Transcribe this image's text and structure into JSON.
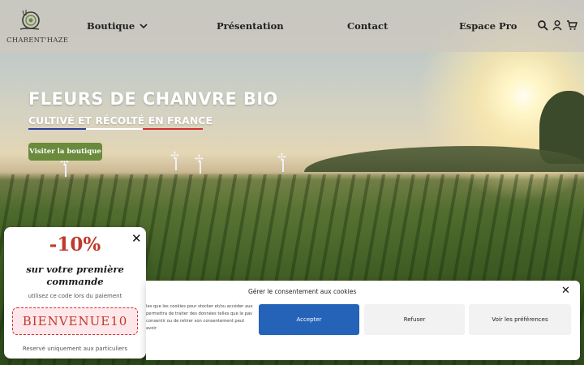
{
  "header": {
    "logo_text": "CHARENT'HAZE",
    "nav": [
      {
        "label": "Boutique",
        "has_dropdown": true
      },
      {
        "label": "Présentation"
      },
      {
        "label": "Contact"
      },
      {
        "label": "Espace Pro"
      }
    ],
    "icons": [
      "search-icon",
      "user-icon",
      "cart-icon"
    ]
  },
  "hero": {
    "title": "Fleurs de chanvre bio",
    "subtitle_part1": "Cultivé et récolté ",
    "subtitle_part2": "en France",
    "cta_label": "Visiter la boutique"
  },
  "promo": {
    "discount": "-10%",
    "line1": "sur votre première",
    "line2": "commande",
    "instruction": "utilisez ce code lors du paiement",
    "code": "BIENVENUE10",
    "note": "Reservé uniquement aux particuliers"
  },
  "cookie": {
    "title": "Gérer le consentement aux cookies",
    "text": "les que les cookies pour stocker et/ou accéder aux permettra de traiter des données telles que le pas consentir ou de retirer son consentement peut avoir",
    "accept_label": "Accepter",
    "refuse_label": "Refuser",
    "prefs_label": "Voir les préférences"
  },
  "colors": {
    "cta": "#6a8a3c",
    "promo_red": "#c0392b",
    "accept_blue": "#2563b8",
    "flag_blue": "#2b3f9e",
    "flag_red": "#d0312d"
  }
}
